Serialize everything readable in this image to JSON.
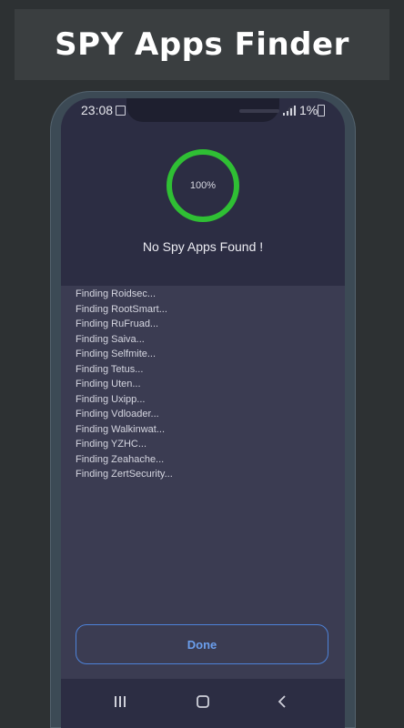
{
  "banner": {
    "title": "SPY Apps Finder"
  },
  "status_bar": {
    "time": "23:08",
    "battery": "1%"
  },
  "scan": {
    "progress": 100,
    "progress_label": "100%",
    "result_message": "No Spy Apps Found !",
    "ring_color": "#2fbf34"
  },
  "log": [
    "Finding Roidsec...",
    "Finding RootSmart...",
    "Finding RuFruad...",
    "Finding Saiva...",
    "Finding Selfmite...",
    "Finding Tetus...",
    "Finding Uten...",
    "Finding Uxipp...",
    "Finding Vdloader...",
    "Finding Walkinwat...",
    "Finding YZHC...",
    "Finding Zeahache...",
    "Finding ZertSecurity..."
  ],
  "actions": {
    "done_label": "Done"
  },
  "nav": {
    "recents": "recents-icon",
    "home": "home-icon",
    "back": "back-icon"
  }
}
